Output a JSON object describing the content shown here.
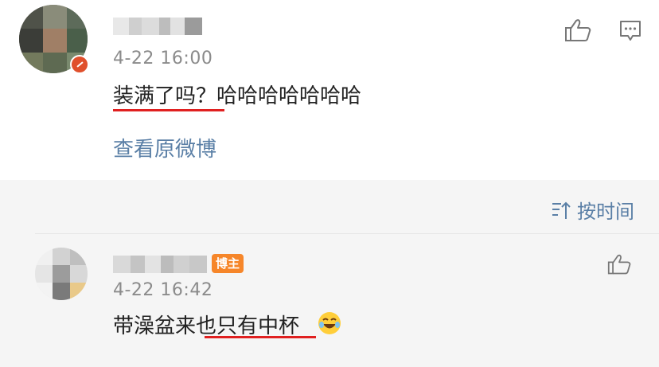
{
  "comment": {
    "time": "4-22 16:00",
    "text": "装满了吗？哈哈哈哈哈哈哈",
    "view_original": "查看原微博"
  },
  "sort": {
    "label": "按时间"
  },
  "reply": {
    "author_tag": "博主",
    "time": "4-22 16:42",
    "text": "带澡盆来也只有中杯",
    "emoji": "laughing-tears-emoji"
  },
  "colors": {
    "link": "#5a7fa6",
    "underline": "#e02020",
    "tag_bg": "#f6862a",
    "verified_badge": "#e0502c"
  },
  "icons": [
    "thumbs-up-icon",
    "comment-icon",
    "sort-icon"
  ]
}
